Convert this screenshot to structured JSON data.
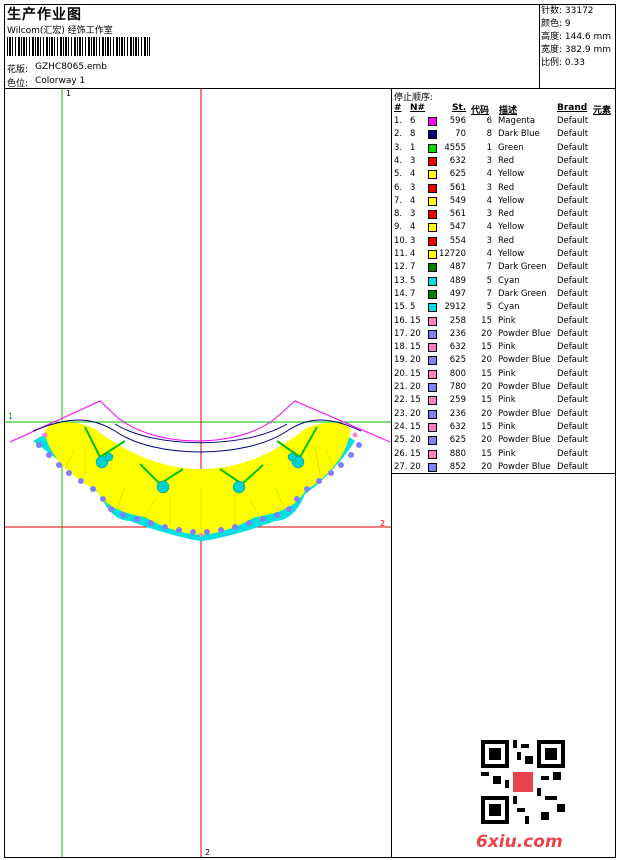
{
  "header": {
    "title": "生产作业图",
    "studio": "Wilcom(汇宏) 经饰工作室",
    "pattern_label": "花版:",
    "pattern_value": "GZHC8065.emb",
    "colorway_label": "色位:",
    "colorway_value": "Colorway 1"
  },
  "stats": {
    "stitches": "针数: 33172",
    "colors": "颜色: 9",
    "height": "高度: 144.6 mm",
    "width": "宽度: 382.9 mm",
    "scale": "比例: 0.33"
  },
  "canvas": {
    "guide_v_left": "1",
    "guide_h_top": "1",
    "guide_h_red": "2",
    "guide_v_red": "2"
  },
  "table": {
    "stop_title": "停止顺序:",
    "col_num": "#",
    "col_n": "N#",
    "col_st": "St.",
    "col_code": "代码",
    "col_desc": "描述",
    "col_brand": "Brand",
    "col_elem": "元素",
    "rows": [
      {
        "num": "1.",
        "n": "6",
        "color": "#ff00ff",
        "st": "596",
        "code": "6",
        "desc": "Magenta",
        "brand": "Default"
      },
      {
        "num": "2.",
        "n": "8",
        "color": "#000080",
        "st": "70",
        "code": "8",
        "desc": "Dark Blue",
        "brand": "Default"
      },
      {
        "num": "3.",
        "n": "1",
        "color": "#00dd00",
        "st": "4555",
        "code": "1",
        "desc": "Green",
        "brand": "Default"
      },
      {
        "num": "4.",
        "n": "3",
        "color": "#ee0000",
        "st": "632",
        "code": "3",
        "desc": "Red",
        "brand": "Default"
      },
      {
        "num": "5.",
        "n": "4",
        "color": "#ffff00",
        "st": "625",
        "code": "4",
        "desc": "Yellow",
        "brand": "Default"
      },
      {
        "num": "6.",
        "n": "3",
        "color": "#ee0000",
        "st": "561",
        "code": "3",
        "desc": "Red",
        "brand": "Default"
      },
      {
        "num": "7.",
        "n": "4",
        "color": "#ffff00",
        "st": "549",
        "code": "4",
        "desc": "Yellow",
        "brand": "Default"
      },
      {
        "num": "8.",
        "n": "3",
        "color": "#ee0000",
        "st": "561",
        "code": "3",
        "desc": "Red",
        "brand": "Default"
      },
      {
        "num": "9.",
        "n": "4",
        "color": "#ffff00",
        "st": "547",
        "code": "4",
        "desc": "Yellow",
        "brand": "Default"
      },
      {
        "num": "10.",
        "n": "3",
        "color": "#ee0000",
        "st": "554",
        "code": "3",
        "desc": "Red",
        "brand": "Default"
      },
      {
        "num": "11.",
        "n": "4",
        "color": "#ffff00",
        "st": "12720",
        "code": "4",
        "desc": "Yellow",
        "brand": "Default"
      },
      {
        "num": "12.",
        "n": "7",
        "color": "#008000",
        "st": "487",
        "code": "7",
        "desc": "Dark Green",
        "brand": "Default"
      },
      {
        "num": "13.",
        "n": "5",
        "color": "#00e0e0",
        "st": "489",
        "code": "5",
        "desc": "Cyan",
        "brand": "Default"
      },
      {
        "num": "14.",
        "n": "7",
        "color": "#008000",
        "st": "497",
        "code": "7",
        "desc": "Dark Green",
        "brand": "Default"
      },
      {
        "num": "15.",
        "n": "5",
        "color": "#00e0e0",
        "st": "2912",
        "code": "5",
        "desc": "Cyan",
        "brand": "Default"
      },
      {
        "num": "16.",
        "n": "15",
        "color": "#ff80c0",
        "st": "258",
        "code": "15",
        "desc": "Pink",
        "brand": "Default"
      },
      {
        "num": "17.",
        "n": "20",
        "color": "#8080ff",
        "st": "236",
        "code": "20",
        "desc": "Powder Blue",
        "brand": "Default"
      },
      {
        "num": "18.",
        "n": "15",
        "color": "#ff80c0",
        "st": "632",
        "code": "15",
        "desc": "Pink",
        "brand": "Default"
      },
      {
        "num": "19.",
        "n": "20",
        "color": "#8080ff",
        "st": "625",
        "code": "20",
        "desc": "Powder Blue",
        "brand": "Default"
      },
      {
        "num": "20.",
        "n": "15",
        "color": "#ff80c0",
        "st": "800",
        "code": "15",
        "desc": "Pink",
        "brand": "Default"
      },
      {
        "num": "21.",
        "n": "20",
        "color": "#8080ff",
        "st": "780",
        "code": "20",
        "desc": "Powder Blue",
        "brand": "Default"
      },
      {
        "num": "22.",
        "n": "15",
        "color": "#ff80c0",
        "st": "259",
        "code": "15",
        "desc": "Pink",
        "brand": "Default"
      },
      {
        "num": "23.",
        "n": "20",
        "color": "#8080ff",
        "st": "236",
        "code": "20",
        "desc": "Powder Blue",
        "brand": "Default"
      },
      {
        "num": "24.",
        "n": "15",
        "color": "#ff80c0",
        "st": "632",
        "code": "15",
        "desc": "Pink",
        "brand": "Default"
      },
      {
        "num": "25.",
        "n": "20",
        "color": "#8080ff",
        "st": "625",
        "code": "20",
        "desc": "Powder Blue",
        "brand": "Default"
      },
      {
        "num": "26.",
        "n": "15",
        "color": "#ff80c0",
        "st": "880",
        "code": "15",
        "desc": "Pink",
        "brand": "Default"
      },
      {
        "num": "27.",
        "n": "20",
        "color": "#8080ff",
        "st": "852",
        "code": "20",
        "desc": "Powder Blue",
        "brand": "Default"
      }
    ]
  },
  "watermark": "6xiu.com",
  "icons": {
    "qr": "qr-code-icon",
    "barcode": "barcode-icon"
  }
}
